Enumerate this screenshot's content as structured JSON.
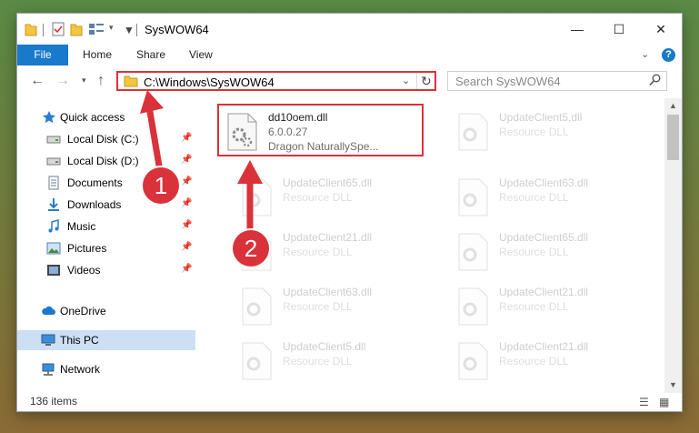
{
  "window": {
    "title": "SysWOW64",
    "minimize_glyph": "—",
    "maximize_glyph": "☐",
    "close_glyph": "✕"
  },
  "ribbon": {
    "file_label": "File",
    "tabs": [
      "Home",
      "Share",
      "View"
    ],
    "help_glyph": "?"
  },
  "address": {
    "path": "C:\\Windows\\SysWOW64",
    "search_placeholder": "Search SysWOW64"
  },
  "sidebar": {
    "items": [
      {
        "label": "Quick access",
        "icon": "star-icon",
        "pinned": false
      },
      {
        "label": "Local Disk (C:)",
        "icon": "drive-icon",
        "pinned": true
      },
      {
        "label": "Local Disk (D:)",
        "icon": "drive-icon",
        "pinned": true
      },
      {
        "label": "Documents",
        "icon": "documents-icon",
        "pinned": true
      },
      {
        "label": "Downloads",
        "icon": "download-icon",
        "pinned": true
      },
      {
        "label": "Music",
        "icon": "music-icon",
        "pinned": true
      },
      {
        "label": "Pictures",
        "icon": "pictures-icon",
        "pinned": true
      },
      {
        "label": "Videos",
        "icon": "videos-icon",
        "pinned": true
      },
      {
        "label": "OneDrive",
        "icon": "cloud-icon",
        "pinned": false
      },
      {
        "label": "This PC",
        "icon": "computer-icon",
        "pinned": false
      },
      {
        "label": "Network",
        "icon": "network-icon",
        "pinned": false
      }
    ]
  },
  "files": {
    "highlighted": {
      "name": "dd10oem.dll",
      "version": "6.0.0.27",
      "company": "Dragon NaturallySpe..."
    },
    "faded": [
      {
        "name": "UpdateClient5.dll",
        "desc": "Resource DLL"
      },
      {
        "name": "UpdateClient65.dll",
        "desc": "Resource DLL"
      },
      {
        "name": "UpdateClient63.dll",
        "desc": "Resource DLL"
      },
      {
        "name": "UpdateClient21.dll",
        "desc": "Resource DLL"
      },
      {
        "name": "UpdateClient65.dll",
        "desc": "Resource DLL"
      },
      {
        "name": "UpdateClient63.dll",
        "desc": "Resource DLL"
      },
      {
        "name": "UpdateClient21.dll",
        "desc": "Resource DLL"
      },
      {
        "name": "UpdateClient5.dll",
        "desc": "Resource DLL"
      },
      {
        "name": "UpdateClient21.dll",
        "desc": "Resource DLL"
      }
    ]
  },
  "status": {
    "item_count": "136 items"
  },
  "annotations": {
    "step1": "1",
    "step2": "2"
  },
  "colors": {
    "accent": "#1979ca",
    "highlight": "#d9323a",
    "selected": "#ccdff3"
  }
}
